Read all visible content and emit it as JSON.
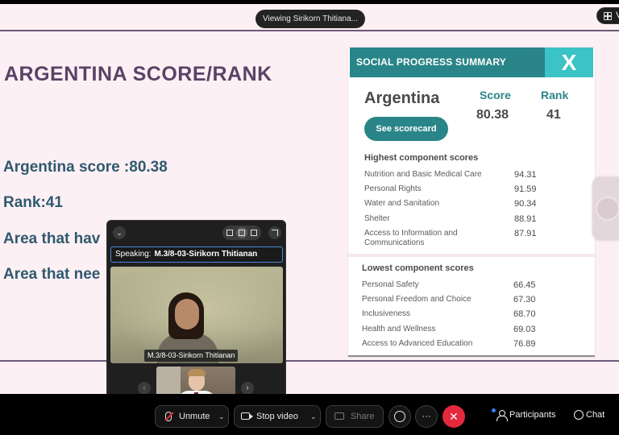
{
  "meeting": {
    "viewing_label": "Viewing Sirikorn Thitiana...",
    "view_button_label": "Vi"
  },
  "slide": {
    "title": "ARGENTINA SCORE/RANK",
    "lines": [
      "Argentina score :80.38",
      "Rank:41",
      "Area that hav",
      "Area that nee"
    ]
  },
  "spi_card": {
    "header": "SOCIAL PROGRESS SUMMARY",
    "close_glyph": "X",
    "country": "Argentina",
    "score_label": "Score",
    "rank_label": "Rank",
    "score_value": "80.38",
    "rank_value": "41",
    "scorecard_button": "See scorecard",
    "highest_title": "Highest component scores",
    "highest": [
      {
        "label": "Nutrition and Basic Medical Care",
        "value": "94.31"
      },
      {
        "label": "Personal Rights",
        "value": "91.59"
      },
      {
        "label": "Water and Sanitation",
        "value": "90.34"
      },
      {
        "label": "Shelter",
        "value": "88.91"
      },
      {
        "label": "Access to Information and Communications",
        "value": "87.91"
      }
    ],
    "lowest_title": "Lowest component scores",
    "lowest": [
      {
        "label": "Personal Safety",
        "value": "66.45"
      },
      {
        "label": "Personal Freedom and Choice",
        "value": "67.30"
      },
      {
        "label": "Inclusiveness",
        "value": "68.70"
      },
      {
        "label": "Health and Wellness",
        "value": "69.03"
      },
      {
        "label": "Access to Advanced Education",
        "value": "76.89"
      }
    ]
  },
  "video_panel": {
    "speaking_prefix": "Speaking:",
    "speaking_name": "M.3/8-03-Sirikorn Thitianan",
    "main_name_tag": "M.3/8-03-Sirikorn Thitianan",
    "prev_glyph": "‹",
    "next_glyph": "›",
    "collapse_glyph": "⌄"
  },
  "controls": {
    "unmute_label": "Unmute",
    "stop_video_label": "Stop video",
    "share_label": "Share",
    "more_label": "···",
    "leave_glyph": "✕",
    "participants_label": "Participants",
    "chat_label": "Chat",
    "caret_glyph": "⌄"
  },
  "icons": {
    "mic": "mic-muted-icon",
    "camera": "video-camera-icon",
    "share": "share-screen-icon",
    "reactions": "emoji-icon",
    "participants": "participants-icon",
    "chat": "chat-icon"
  },
  "colors": {
    "slide_background": "#fdf0f4",
    "title": "#5a4266",
    "body_text": "#2f5a6e",
    "teal": "#2a8588",
    "teal_light": "#3cc3c6",
    "leave_red": "#e5293c",
    "speaker_border": "#4a8bd6"
  }
}
